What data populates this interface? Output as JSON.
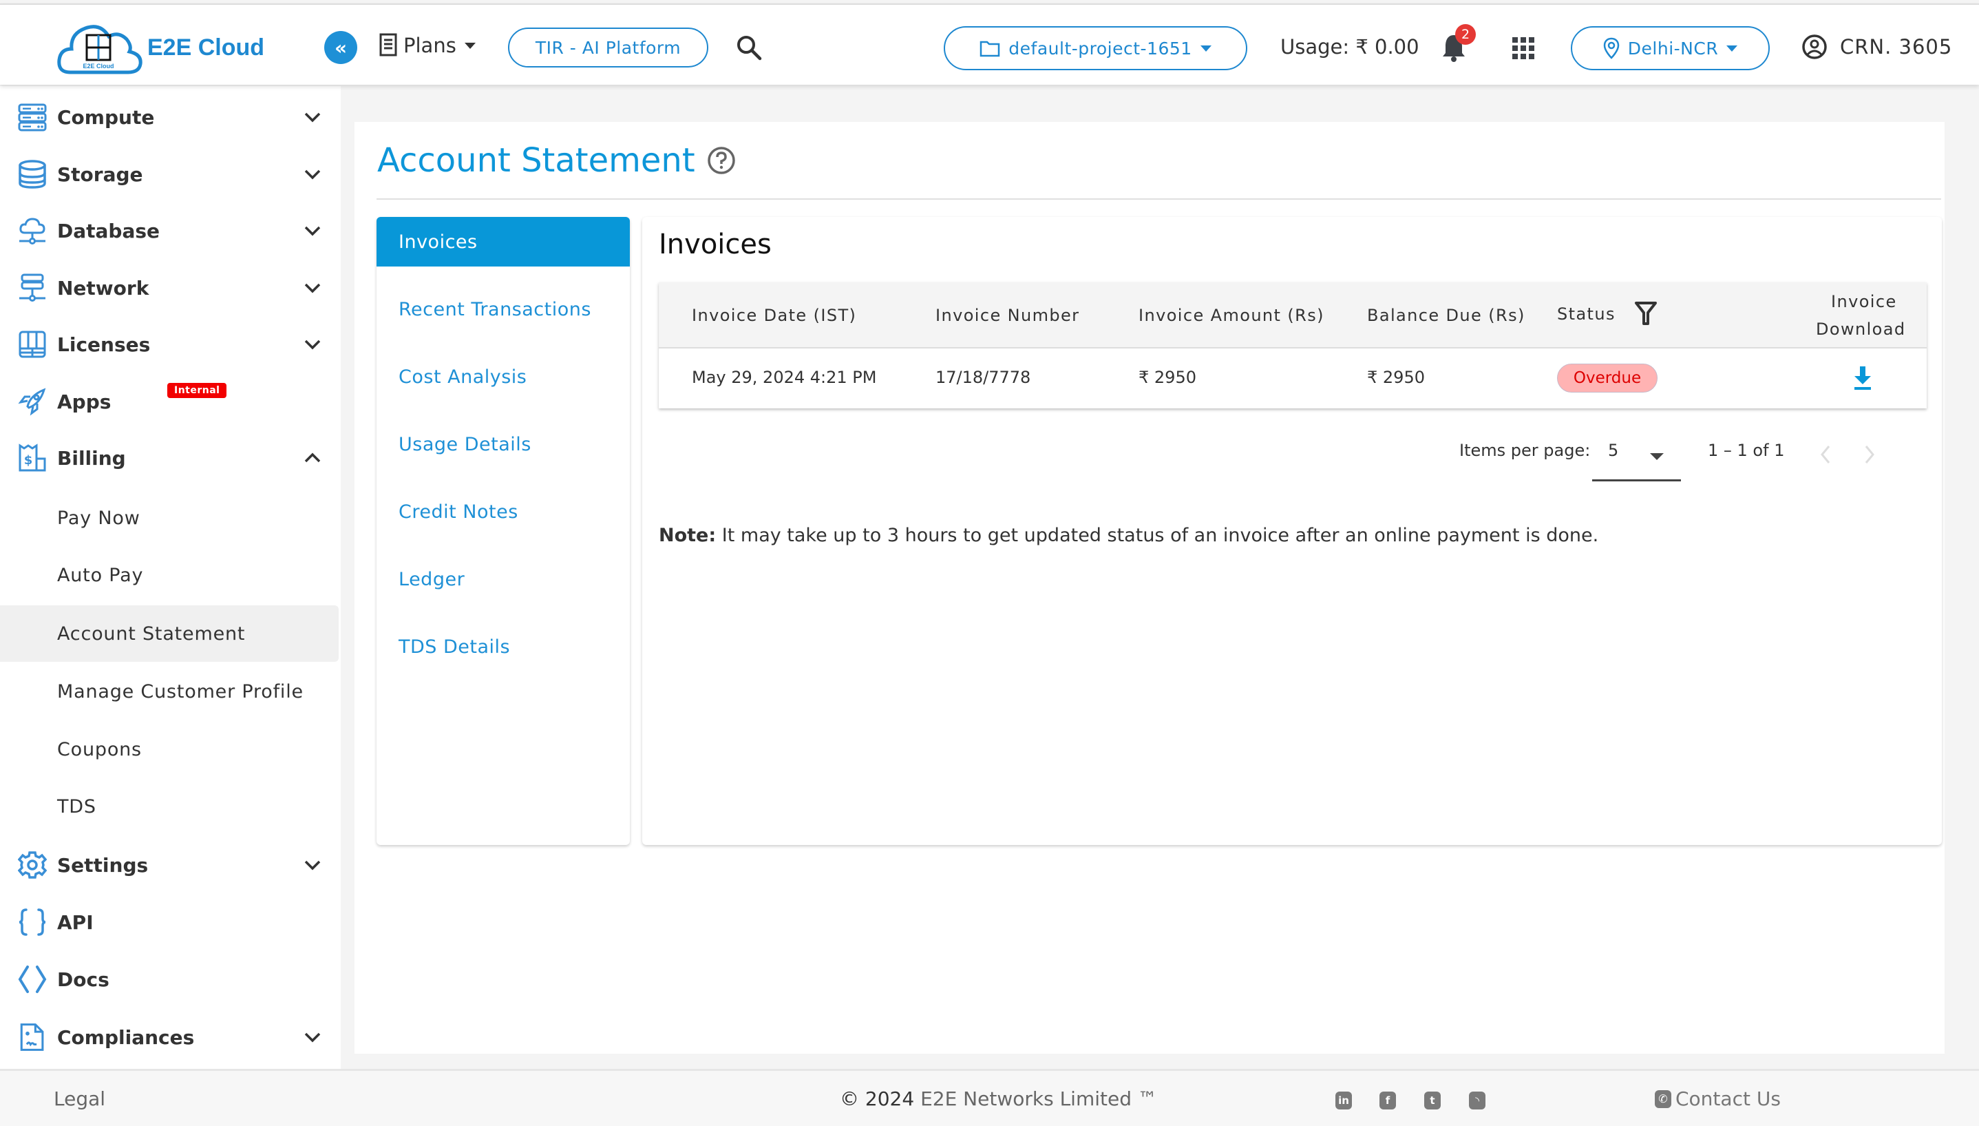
{
  "header": {
    "logo_text": "E2E Cloud",
    "logo_badge_text": "E2E Cloud",
    "plans_label": "Plans",
    "tir_button": "TIR - AI Platform",
    "project_selector": "default-project-1651",
    "usage": "Usage: ₹ 0.00",
    "notification_count": "2",
    "region_selector": "Delhi-NCR",
    "crn": "CRN. 3605",
    "collapse_glyph": "«"
  },
  "sidebar": {
    "items": [
      {
        "label": "Compute",
        "icon": "server-icon",
        "expanded": false
      },
      {
        "label": "Storage",
        "icon": "database-icon",
        "expanded": false
      },
      {
        "label": "Database",
        "icon": "cloud-network-icon",
        "expanded": false
      },
      {
        "label": "Network",
        "icon": "network-icon",
        "expanded": false
      },
      {
        "label": "Licenses",
        "icon": "licenses-icon",
        "expanded": false
      },
      {
        "label": "Apps",
        "icon": "rocket-icon",
        "badge": "Internal"
      },
      {
        "label": "Billing",
        "icon": "billing-icon",
        "expanded": true
      },
      {
        "label": "Settings",
        "icon": "gear-icon",
        "expanded": false
      },
      {
        "label": "API",
        "icon": "braces-icon"
      },
      {
        "label": "Docs",
        "icon": "code-icon"
      },
      {
        "label": "Compliances",
        "icon": "document-icon",
        "expanded": false
      }
    ],
    "billing_subitems": [
      {
        "label": "Pay Now"
      },
      {
        "label": "Auto Pay"
      },
      {
        "label": "Account Statement",
        "active": true
      },
      {
        "label": "Manage Customer Profile"
      },
      {
        "label": "Coupons"
      },
      {
        "label": "TDS"
      }
    ]
  },
  "page": {
    "title": "Account Statement",
    "tabs": [
      {
        "label": "Invoices",
        "active": true
      },
      {
        "label": "Recent Transactions"
      },
      {
        "label": "Cost Analysis"
      },
      {
        "label": "Usage Details"
      },
      {
        "label": "Credit Notes"
      },
      {
        "label": "Ledger"
      },
      {
        "label": "TDS Details"
      }
    ],
    "section_title": "Invoices",
    "table": {
      "columns": [
        "Invoice Date (IST)",
        "Invoice Number",
        "Invoice Amount (Rs)",
        "Balance Due (Rs)",
        "Status",
        "Invoice",
        "Download"
      ],
      "rows": [
        {
          "date": "May 29, 2024 4:21 PM",
          "number": "17/18/7778",
          "amount": "₹ 2950",
          "balance": "₹ 2950",
          "status": "Overdue"
        }
      ]
    },
    "paginator": {
      "items_per_page_label": "Items per page:",
      "items_per_page": "5",
      "range": "1 – 1 of 1"
    },
    "note_label": "Note:",
    "note_text": " It may take up to 3 hours to get updated status of an invoice after an online payment is done."
  },
  "footer": {
    "legal": "Legal",
    "copyright_year": "© 2024",
    "copyright_company": " E2E Networks Limited ™",
    "contact": "Contact Us",
    "social": [
      {
        "name": "linkedin-icon",
        "glyph": "in"
      },
      {
        "name": "facebook-icon",
        "glyph": "f"
      },
      {
        "name": "twitter-icon",
        "glyph": "t"
      },
      {
        "name": "rss-icon",
        "glyph": "◝"
      }
    ]
  },
  "colors": {
    "brand": "#1e88d0",
    "accent": "#0897d8",
    "overdue_bg": "#ffb3b3",
    "overdue_text": "#dd0000",
    "badge_red": "#e53935",
    "internal_red": "#f20000"
  }
}
